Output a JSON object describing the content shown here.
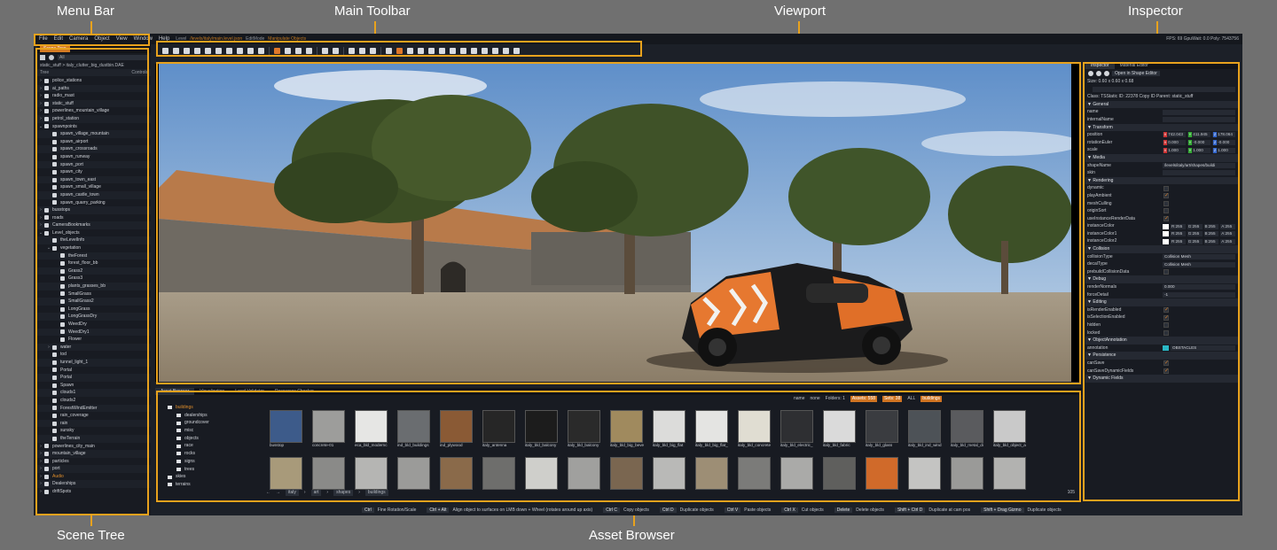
{
  "callouts": {
    "menu_bar": "Menu Bar",
    "main_toolbar": "Main Toolbar",
    "viewport": "Viewport",
    "inspector": "Inspector",
    "scene_tree": "Scene Tree",
    "asset_browser": "Asset Browser"
  },
  "menubar": {
    "items": [
      "File",
      "Edit",
      "Camera",
      "Object",
      "View",
      "Window",
      "Help"
    ],
    "level_label": "Level",
    "level_path": "/levels/italy/main.level.json",
    "edit_mode_label": "EditMode",
    "edit_mode_value": "Manipulate Objects",
    "fps": "FPS: 69  GpuWait: 0.0  Poly: 7543756"
  },
  "scene": {
    "tab": "Scene Tree",
    "filter": "All",
    "path": "static_stuff  >  italy_clutter_big_dustbin.DAE",
    "head_left": "Tree",
    "head_right": "Controls",
    "rows": [
      {
        "label": "police_stations",
        "indent": 0,
        "arrow": "›"
      },
      {
        "label": "ai_paths",
        "indent": 0,
        "arrow": "›"
      },
      {
        "label": "radio_mast",
        "indent": 0,
        "arrow": "›"
      },
      {
        "label": "static_stuff",
        "indent": 0,
        "arrow": "›"
      },
      {
        "label": "powerlines_mountain_village",
        "indent": 0,
        "arrow": "›"
      },
      {
        "label": "petrol_station",
        "indent": 0,
        "arrow": "›"
      },
      {
        "label": "spawnpoints",
        "indent": 0,
        "arrow": "⌄"
      },
      {
        "label": "spawn_village_mountain",
        "indent": 1,
        "arrow": ""
      },
      {
        "label": "spawn_airport",
        "indent": 1,
        "arrow": ""
      },
      {
        "label": "spawn_crossroads",
        "indent": 1,
        "arrow": ""
      },
      {
        "label": "spawn_runway",
        "indent": 1,
        "arrow": ""
      },
      {
        "label": "spawn_port",
        "indent": 1,
        "arrow": ""
      },
      {
        "label": "spawn_city",
        "indent": 1,
        "arrow": ""
      },
      {
        "label": "spawn_town_east",
        "indent": 1,
        "arrow": ""
      },
      {
        "label": "spawn_small_village",
        "indent": 1,
        "arrow": ""
      },
      {
        "label": "spawn_castle_town",
        "indent": 1,
        "arrow": ""
      },
      {
        "label": "spawn_quarry_parking",
        "indent": 1,
        "arrow": ""
      },
      {
        "label": "busstops",
        "indent": 0,
        "arrow": "›"
      },
      {
        "label": "roads",
        "indent": 0,
        "arrow": "›"
      },
      {
        "label": "CameraBookmarks",
        "indent": 0,
        "arrow": "›"
      },
      {
        "label": "Level_objects",
        "indent": 0,
        "arrow": "⌄"
      },
      {
        "label": "theLevelInfo",
        "indent": 1,
        "arrow": ""
      },
      {
        "label": "vegetation",
        "indent": 1,
        "arrow": "⌄"
      },
      {
        "label": "theForest",
        "indent": 2,
        "arrow": ""
      },
      {
        "label": "forest_floor_bb",
        "indent": 2,
        "arrow": ""
      },
      {
        "label": "Grass2",
        "indent": 2,
        "arrow": ""
      },
      {
        "label": "Grass3",
        "indent": 2,
        "arrow": ""
      },
      {
        "label": "plants_grasses_bb",
        "indent": 2,
        "arrow": ""
      },
      {
        "label": "SmallGrass",
        "indent": 2,
        "arrow": ""
      },
      {
        "label": "SmallGrass2",
        "indent": 2,
        "arrow": ""
      },
      {
        "label": "LongGrass",
        "indent": 2,
        "arrow": ""
      },
      {
        "label": "LongGrassDry",
        "indent": 2,
        "arrow": ""
      },
      {
        "label": "WeedDry",
        "indent": 2,
        "arrow": ""
      },
      {
        "label": "WeedDry1",
        "indent": 2,
        "arrow": ""
      },
      {
        "label": "Flower",
        "indent": 2,
        "arrow": ""
      },
      {
        "label": "water",
        "indent": 1,
        "arrow": "›"
      },
      {
        "label": "tod",
        "indent": 1,
        "arrow": ""
      },
      {
        "label": "tunnel_light_1",
        "indent": 1,
        "arrow": ""
      },
      {
        "label": "Portal",
        "indent": 1,
        "arrow": ""
      },
      {
        "label": "Portal",
        "indent": 1,
        "arrow": ""
      },
      {
        "label": "Spawn",
        "indent": 1,
        "arrow": ""
      },
      {
        "label": "clouds1",
        "indent": 1,
        "arrow": ""
      },
      {
        "label": "clouds2",
        "indent": 1,
        "arrow": ""
      },
      {
        "label": "ForestWindEmitter",
        "indent": 1,
        "arrow": ""
      },
      {
        "label": "rain_coverage",
        "indent": 1,
        "arrow": ""
      },
      {
        "label": "rain",
        "indent": 1,
        "arrow": ""
      },
      {
        "label": "sunsky",
        "indent": 1,
        "arrow": ""
      },
      {
        "label": "theTerrain",
        "indent": 1,
        "arrow": ""
      },
      {
        "label": "powerlines_city_main",
        "indent": 0,
        "arrow": "›"
      },
      {
        "label": "mountain_village",
        "indent": 0,
        "arrow": "›"
      },
      {
        "label": "particles",
        "indent": 0,
        "arrow": "›"
      },
      {
        "label": "port",
        "indent": 0,
        "arrow": "›"
      },
      {
        "label": "Audio",
        "indent": 0,
        "arrow": "›",
        "hi": true
      },
      {
        "label": "Dealerships",
        "indent": 0,
        "arrow": "›"
      },
      {
        "label": "driftSpots",
        "indent": 0,
        "arrow": "›"
      }
    ]
  },
  "assets": {
    "tabs": [
      "Asset Browser",
      "Visualization",
      "Level Validator",
      "Resources Checker"
    ],
    "filter": [
      "name",
      "none",
      "Folders: 1",
      "Assets: 558",
      "Sets: 38",
      "ALL",
      "buildings"
    ],
    "folders": [
      {
        "label": "buildings",
        "indent": 0,
        "hi": true
      },
      {
        "label": "dealerships",
        "indent": 1
      },
      {
        "label": "groundcover",
        "indent": 1
      },
      {
        "label": "misc",
        "indent": 1
      },
      {
        "label": "objects",
        "indent": 1
      },
      {
        "label": "race",
        "indent": 1
      },
      {
        "label": "rocks",
        "indent": 1
      },
      {
        "label": "signs",
        "indent": 1
      },
      {
        "label": "trees",
        "indent": 1
      },
      {
        "label": "skies",
        "indent": 0
      },
      {
        "label": "terrains",
        "indent": 0
      }
    ],
    "thumbs_row1": [
      {
        "label": "busstop",
        "color": "#3d5b8a"
      },
      {
        "label": "concrete-01",
        "color": "#9d9d9b"
      },
      {
        "label": "eca_bld_modernc",
        "color": "#e6e6e4"
      },
      {
        "label": "ind_bld_buildings",
        "color": "#6a6d70"
      },
      {
        "label": "ind_plywood",
        "color": "#8a5a35"
      },
      {
        "label": "italy_antenna",
        "color": "#262626"
      },
      {
        "label": "italy_bld_balcony",
        "color": "#1c1c1c"
      },
      {
        "label": "italy_bld_balcony",
        "color": "#2a2a2a"
      },
      {
        "label": "italy_bld_big_beve",
        "color": "#a08a5e"
      },
      {
        "label": "italy_bld_big_flat",
        "color": "#dcdcda"
      },
      {
        "label": "italy_bld_big_flat_",
        "color": "#e4e4e2"
      },
      {
        "label": "italy_bld_concrete",
        "color": "#e0ddd2"
      },
      {
        "label": "italy_bld_electric_",
        "color": "#2e2f32"
      },
      {
        "label": "italy_bld_fabric",
        "color": "#dadada"
      },
      {
        "label": "italy_bld_glass",
        "color": "#3a3c40"
      },
      {
        "label": "italy_bld_ind_wind",
        "color": "#4d5257"
      },
      {
        "label": "italy_bld_metal_di",
        "color": "#5a5b5e"
      },
      {
        "label": "italy_bld_object_a",
        "color": "#c9c9c9"
      }
    ],
    "thumbs_row2": [
      {
        "color": "#a89a7a"
      },
      {
        "color": "#8a8a88"
      },
      {
        "color": "#b5b5b3"
      },
      {
        "color": "#9b9b99"
      },
      {
        "color": "#8a6a4a"
      },
      {
        "color": "#6e6e6c"
      },
      {
        "color": "#cfcfcb"
      },
      {
        "color": "#a0a09e"
      },
      {
        "color": "#7a6650"
      },
      {
        "color": "#b9b9b7"
      },
      {
        "color": "#9d8e75"
      },
      {
        "color": "#7b7b79"
      },
      {
        "color": "#aaaaa8"
      },
      {
        "color": "#5f5f5d"
      },
      {
        "color": "#d06a2a"
      },
      {
        "color": "#c4c4c2"
      },
      {
        "color": "#9a9a98"
      },
      {
        "color": "#b2b2b0"
      }
    ],
    "path": [
      "italy",
      "art",
      "shapes",
      "buildings"
    ],
    "count": "105"
  },
  "inspector": {
    "tabs": [
      "Inspector",
      "Material Editor"
    ],
    "open_shape_editor": "Open in Shape Editor",
    "size": "Size: 0.60 x 0.60 x 0.68",
    "class_line": "Class:  TSStatic     ID:  22378   Copy ID   Parent:  static_stuff",
    "rows": [
      {
        "type": "sec",
        "k": "General"
      },
      {
        "type": "val",
        "k": "name",
        "v": ""
      },
      {
        "type": "val",
        "k": "internalName",
        "v": ""
      },
      {
        "type": "sec",
        "k": "Transform"
      },
      {
        "type": "vec",
        "k": "position",
        "v": [
          "742.043",
          "411.945",
          "178.064"
        ]
      },
      {
        "type": "vec",
        "k": "rotationEuler",
        "v": [
          "0.000",
          "-0.000",
          "-0.000"
        ]
      },
      {
        "type": "vec",
        "k": "scale",
        "v": [
          "1.000",
          "1.000",
          "1.000"
        ]
      },
      {
        "type": "sec",
        "k": "Media"
      },
      {
        "type": "val",
        "k": "shapeName",
        "v": "/levels/italy/art/shapes/buildi"
      },
      {
        "type": "val",
        "k": "skin",
        "v": ""
      },
      {
        "type": "sec",
        "k": "Rendering"
      },
      {
        "type": "chk",
        "k": "dynamic",
        "on": false
      },
      {
        "type": "chk",
        "k": "playAmbient",
        "on": true
      },
      {
        "type": "chk",
        "k": "meshCulling",
        "on": false
      },
      {
        "type": "chk",
        "k": "originSort",
        "on": false
      },
      {
        "type": "chk",
        "k": "useInstanceRenderData",
        "on": true
      },
      {
        "type": "col",
        "k": "instanceColor",
        "v": [
          "R:255",
          "G:255",
          "B:255",
          "A:255"
        ]
      },
      {
        "type": "col",
        "k": "instanceColor1",
        "v": [
          "R:255",
          "G:255",
          "B:255",
          "A:255"
        ]
      },
      {
        "type": "col",
        "k": "instanceColor2",
        "v": [
          "R:255",
          "G:255",
          "B:255",
          "A:255"
        ]
      },
      {
        "type": "sec",
        "k": "Collision"
      },
      {
        "type": "val",
        "k": "collisionType",
        "v": "Collision Mesh"
      },
      {
        "type": "val",
        "k": "decalType",
        "v": "Collision Mesh"
      },
      {
        "type": "chk",
        "k": "prebuildCollisionData",
        "on": false
      },
      {
        "type": "sec",
        "k": "Debug"
      },
      {
        "type": "val",
        "k": "renderNormals",
        "v": "0.000"
      },
      {
        "type": "val",
        "k": "forceDetail",
        "v": "-1"
      },
      {
        "type": "sec",
        "k": "Editing"
      },
      {
        "type": "chk",
        "k": "isRenderEnabled",
        "on": true
      },
      {
        "type": "chk",
        "k": "isSelectionEnabled",
        "on": true
      },
      {
        "type": "chk",
        "k": "hidden",
        "on": false
      },
      {
        "type": "chk",
        "k": "locked",
        "on": false
      },
      {
        "type": "sec",
        "k": "ObjectAnnotation"
      },
      {
        "type": "ann",
        "k": "annotation",
        "v": "OBSTACLES"
      },
      {
        "type": "sec",
        "k": "Persistence"
      },
      {
        "type": "chk",
        "k": "canSave",
        "on": true
      },
      {
        "type": "chk",
        "k": "canSaveDynamicFields",
        "on": true
      },
      {
        "type": "sec",
        "k": "Dynamic Fields"
      }
    ]
  },
  "status": [
    {
      "key": "Ctrl",
      "desc": "Fine Rotation/Scale"
    },
    {
      "key": "Ctrl + Alt",
      "desc": "Align object to surfaces on LMB down + Wheel (rotates around up axis)"
    },
    {
      "key": "Ctrl C",
      "desc": "Copy objects"
    },
    {
      "key": "Ctrl D",
      "desc": "Duplicate objects"
    },
    {
      "key": "Ctrl V",
      "desc": "Paste objects"
    },
    {
      "key": "Ctrl X",
      "desc": "Cut objects"
    },
    {
      "key": "Delete",
      "desc": "Delete objects"
    },
    {
      "key": "Shift + Ctrl D",
      "desc": "Duplicate at cam pos"
    },
    {
      "key": "Shift + Drag Gizmo",
      "desc": "Duplicate objects"
    }
  ],
  "colors": {
    "accent": "#e8a21d",
    "panel": "#181b22",
    "selected": "#d37a22"
  }
}
